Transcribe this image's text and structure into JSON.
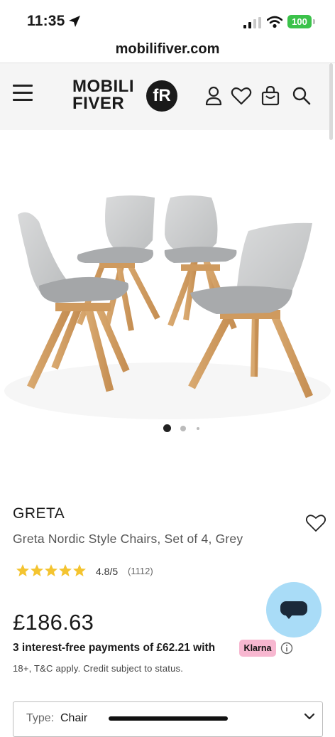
{
  "status_bar": {
    "time": "11:35",
    "battery": "100"
  },
  "browser": {
    "url": "mobilifiver.com"
  },
  "header": {
    "logo_line1": "MOBILI",
    "logo_line2": "FIVER",
    "logo_badge": "fR",
    "icons": [
      "menu-icon",
      "user-icon",
      "heart-icon",
      "bag-icon",
      "search-icon"
    ]
  },
  "gallery": {
    "total_images": 3,
    "active_index": 0
  },
  "product": {
    "brand": "GRETA",
    "title": "Greta Nordic Style Chairs, Set of 4, Grey",
    "rating": {
      "stars": 5,
      "value": "4.8/5",
      "count": "(1112)"
    },
    "price": "£186.63",
    "installments": "3 interest-free payments of £62.21 with",
    "klarna_label": "Klarna",
    "credit_note": "18+, T&C apply. Credit subject to status."
  },
  "options": {
    "type_label": "Type:",
    "type_value": "Chair"
  },
  "colors": {
    "star": "#f4c430",
    "klarna": "#f7b7d0",
    "battery": "#3bc24a",
    "chat": "#a9dcf7"
  }
}
